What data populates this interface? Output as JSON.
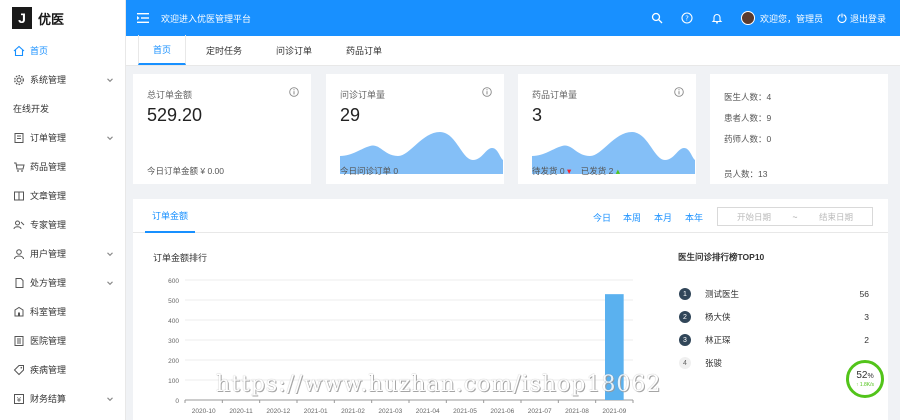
{
  "app": {
    "logo_letter": "J",
    "name": "优医"
  },
  "header": {
    "welcome": "欢迎进入优医管理平台",
    "user": "欢迎您，管理员",
    "logout": "退出登录"
  },
  "sidebar": {
    "items": [
      {
        "label": "首页",
        "icon": "home-icon",
        "active": true,
        "expand": false
      },
      {
        "label": "系统管理",
        "icon": "gear-icon",
        "expand": true
      },
      {
        "label": "在线开发",
        "icon": "",
        "expand": false
      },
      {
        "label": "订单管理",
        "icon": "order-icon",
        "expand": true
      },
      {
        "label": "药品管理",
        "icon": "cart-icon",
        "expand": false
      },
      {
        "label": "文章管理",
        "icon": "article-icon",
        "expand": false
      },
      {
        "label": "专家管理",
        "icon": "expert-icon",
        "expand": false
      },
      {
        "label": "用户管理",
        "icon": "user-icon",
        "expand": true
      },
      {
        "label": "处方管理",
        "icon": "prescription-icon",
        "expand": true
      },
      {
        "label": "科室管理",
        "icon": "department-icon",
        "expand": false
      },
      {
        "label": "医院管理",
        "icon": "hospital-icon",
        "expand": false
      },
      {
        "label": "疾病管理",
        "icon": "tag-icon",
        "expand": false
      },
      {
        "label": "财务结算",
        "icon": "finance-icon",
        "expand": true
      }
    ]
  },
  "tabs": [
    {
      "label": "首页",
      "active": true
    },
    {
      "label": "定时任务"
    },
    {
      "label": "问诊订单"
    },
    {
      "label": "药品订单"
    }
  ],
  "cards": {
    "total": {
      "title": "总订单金额",
      "value": "529.20",
      "foot": "今日订单金额 ¥ 0.00"
    },
    "consult": {
      "title": "问诊订单量",
      "value": "29",
      "foot": "今日问诊订单 0"
    },
    "drug": {
      "title": "药品订单量",
      "value": "3",
      "pending_label": "待发货",
      "pending": "0",
      "shipped_label": "已发货",
      "shipped": "2"
    },
    "people": {
      "doctor": "医生人数：4",
      "patient": "患者人数：9",
      "pharmacist": "药师人数：0",
      "staff": "员人数：13"
    }
  },
  "panel": {
    "tab": "订单金额",
    "quick": [
      "今日",
      "本周",
      "本月",
      "本年"
    ],
    "start_placeholder": "开始日期",
    "separator": "~",
    "end_placeholder": "结束日期",
    "chart_title": "订单金额排行",
    "rank_title": "医生问诊排行榜TOP10",
    "ranking": [
      {
        "rank": "1",
        "name": "测试医生",
        "value": "56"
      },
      {
        "rank": "2",
        "name": "杨大侠",
        "value": "3"
      },
      {
        "rank": "3",
        "name": "林正琛",
        "value": "2"
      },
      {
        "rank": "4",
        "name": "张骏",
        "value": ""
      }
    ]
  },
  "speed_widget": {
    "percent": "52",
    "unit": "%",
    "rate": "↑ 1.8K/s"
  },
  "watermark": "https://www.huzhan.com/ishop18062",
  "colors": {
    "primary": "#1890ff",
    "bar": "#5ab1ef",
    "wave": "#84bff7"
  },
  "chart_data": {
    "type": "bar",
    "categories": [
      "2020-10",
      "2020-11",
      "2020-12",
      "2021-01",
      "2021-02",
      "2021-03",
      "2021-04",
      "2021-05",
      "2021-06",
      "2021-07",
      "2021-08",
      "2021-09"
    ],
    "values": [
      0,
      0,
      0,
      0,
      0,
      0,
      0,
      0,
      0,
      0,
      0,
      529.2
    ],
    "yticks": [
      0,
      100,
      200,
      300,
      400,
      500,
      600
    ],
    "ylim": [
      0,
      600
    ],
    "title": "订单金额排行",
    "grid": true
  }
}
